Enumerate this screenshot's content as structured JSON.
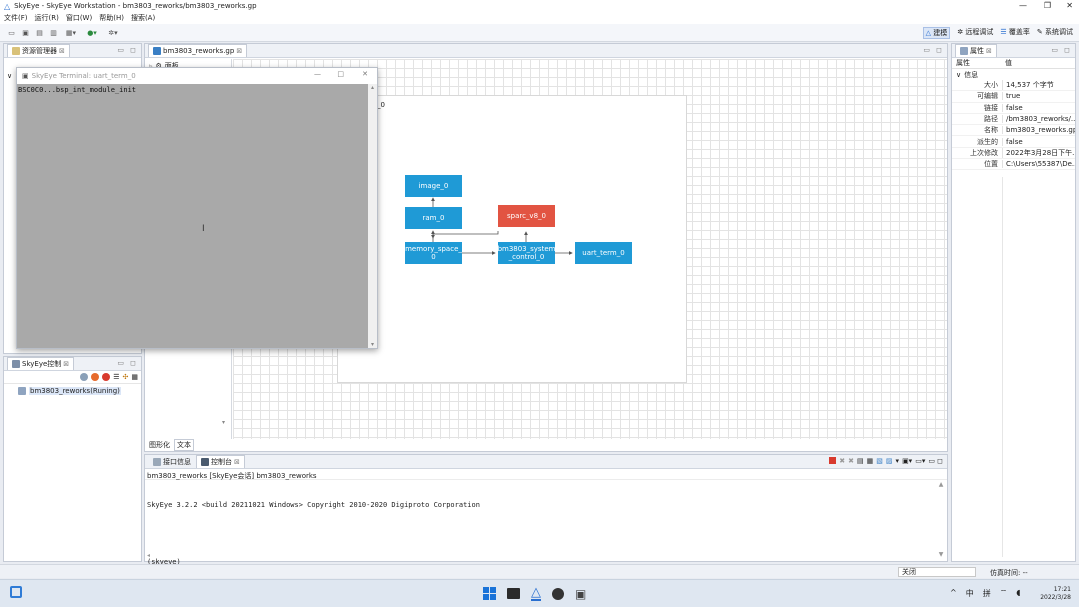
{
  "window": {
    "title": "SkyEye - SkyEye Workstation - bm3803_reworks/bm3803_reworks.gp",
    "minimize": "—",
    "restore": "❐",
    "close": "✕"
  },
  "menu": [
    "文件(F)",
    "运行(R)",
    "窗口(W)",
    "帮助(H)",
    "搜索(A)"
  ],
  "perspectives": [
    "建模",
    "远程调试",
    "覆盖率",
    "系统调试"
  ],
  "explorer": {
    "tab": "资源管理器"
  },
  "editor": {
    "tab": "bm3803_reworks.gp",
    "palette_title": "面板",
    "bottom_tabs": [
      "图形化",
      "文本"
    ],
    "corner_label": "_0"
  },
  "diagram": {
    "nodes": {
      "image": "image_0",
      "ram": "ram_0",
      "sparc": "sparc_v8_0",
      "memory_space": "memory_space_\n0",
      "system_control": "bm3803_system\n_control_0",
      "uart": "uart_term_0"
    },
    "colors": {
      "blue": "#1f9ad6",
      "red": "#e25442"
    }
  },
  "terminal": {
    "title": "SkyEye Terminal: uart_term_0",
    "line": "BSC0C0...bsp_int_module_init"
  },
  "skyeye_ctrl": {
    "tab": "SkyEye控制",
    "item": "bm3803_reworks(Runing)"
  },
  "properties": {
    "tab": "属性",
    "col_prop": "属性",
    "col_value": "值",
    "group": "信息",
    "rows": [
      {
        "k": "大小",
        "v": "14,537 个字节"
      },
      {
        "k": "可编辑",
        "v": "true"
      },
      {
        "k": "链接",
        "v": "false"
      },
      {
        "k": "路径",
        "v": "/bm3803_reworks/..."
      },
      {
        "k": "名称",
        "v": "bm3803_reworks.gp"
      },
      {
        "k": "派生的",
        "v": "false"
      },
      {
        "k": "上次修改",
        "v": "2022年3月28日下午..."
      },
      {
        "k": "位置",
        "v": "C:\\Users\\55387\\De..."
      }
    ]
  },
  "console": {
    "tabs": [
      "接口信息",
      "控制台"
    ],
    "header": "bm3803_reworks [SkyEye会话] bm3803_reworks",
    "lines": [
      "SkyEye 3.2.2 <build 20211021 Windows> Copyright 2010-2020 Digiproto Corporation",
      "",
      "(skyeye)"
    ]
  },
  "status": {
    "close_label": "关闭",
    "sim_time": "仿真时间: --"
  },
  "taskbar": {
    "tray": [
      "^",
      "中",
      "拼"
    ],
    "time": "17:21",
    "date": "2022/3/28"
  }
}
